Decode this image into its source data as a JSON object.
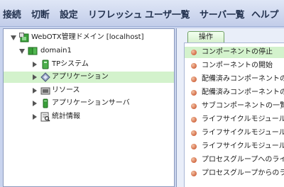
{
  "menu": {
    "items": [
      {
        "label": "接続"
      },
      {
        "label": "切断"
      },
      {
        "label": "設定"
      },
      {
        "label": "リフレッシュ"
      },
      {
        "label": "ユーザ一覧"
      },
      {
        "label": "サーバ一覧"
      },
      {
        "label": "ヘルプ"
      }
    ]
  },
  "tree": {
    "root": {
      "label": "WebOTX管理ドメイン [localhost]",
      "icon": "domain-admin-icon"
    },
    "domain": {
      "label": "domain1",
      "icon": "domain-icon"
    },
    "children": [
      {
        "label": "TPシステム",
        "icon": "tp-system-icon"
      },
      {
        "label": "アプリケーション",
        "icon": "application-icon",
        "selected": true
      },
      {
        "label": "リソース",
        "icon": "resource-icon"
      },
      {
        "label": "アプリケーションサーバ",
        "icon": "app-server-icon"
      },
      {
        "label": "統計情報",
        "icon": "statistics-icon"
      }
    ]
  },
  "operations": {
    "tab_label": "操作",
    "items": [
      {
        "label": "コンポーネントの停止",
        "selected": true
      },
      {
        "label": "コンポーネントの開始"
      },
      {
        "label": "配備済みコンポーネントの一"
      },
      {
        "label": "配備済みコンポーネントの’"
      },
      {
        "label": "サブコンポーネントの一覧え"
      },
      {
        "label": "ライフサイクルモジュールの"
      },
      {
        "label": "ライフサイクルモジュールの"
      },
      {
        "label": "ライフサイクルモジュール祐"
      },
      {
        "label": "プロセスグループへのライフ"
      },
      {
        "label": "プロセスグループからのラ・"
      }
    ]
  },
  "colors": {
    "selection": "#d3f2cc",
    "menu_text": "#23324f",
    "background": "#c9d4ee"
  }
}
